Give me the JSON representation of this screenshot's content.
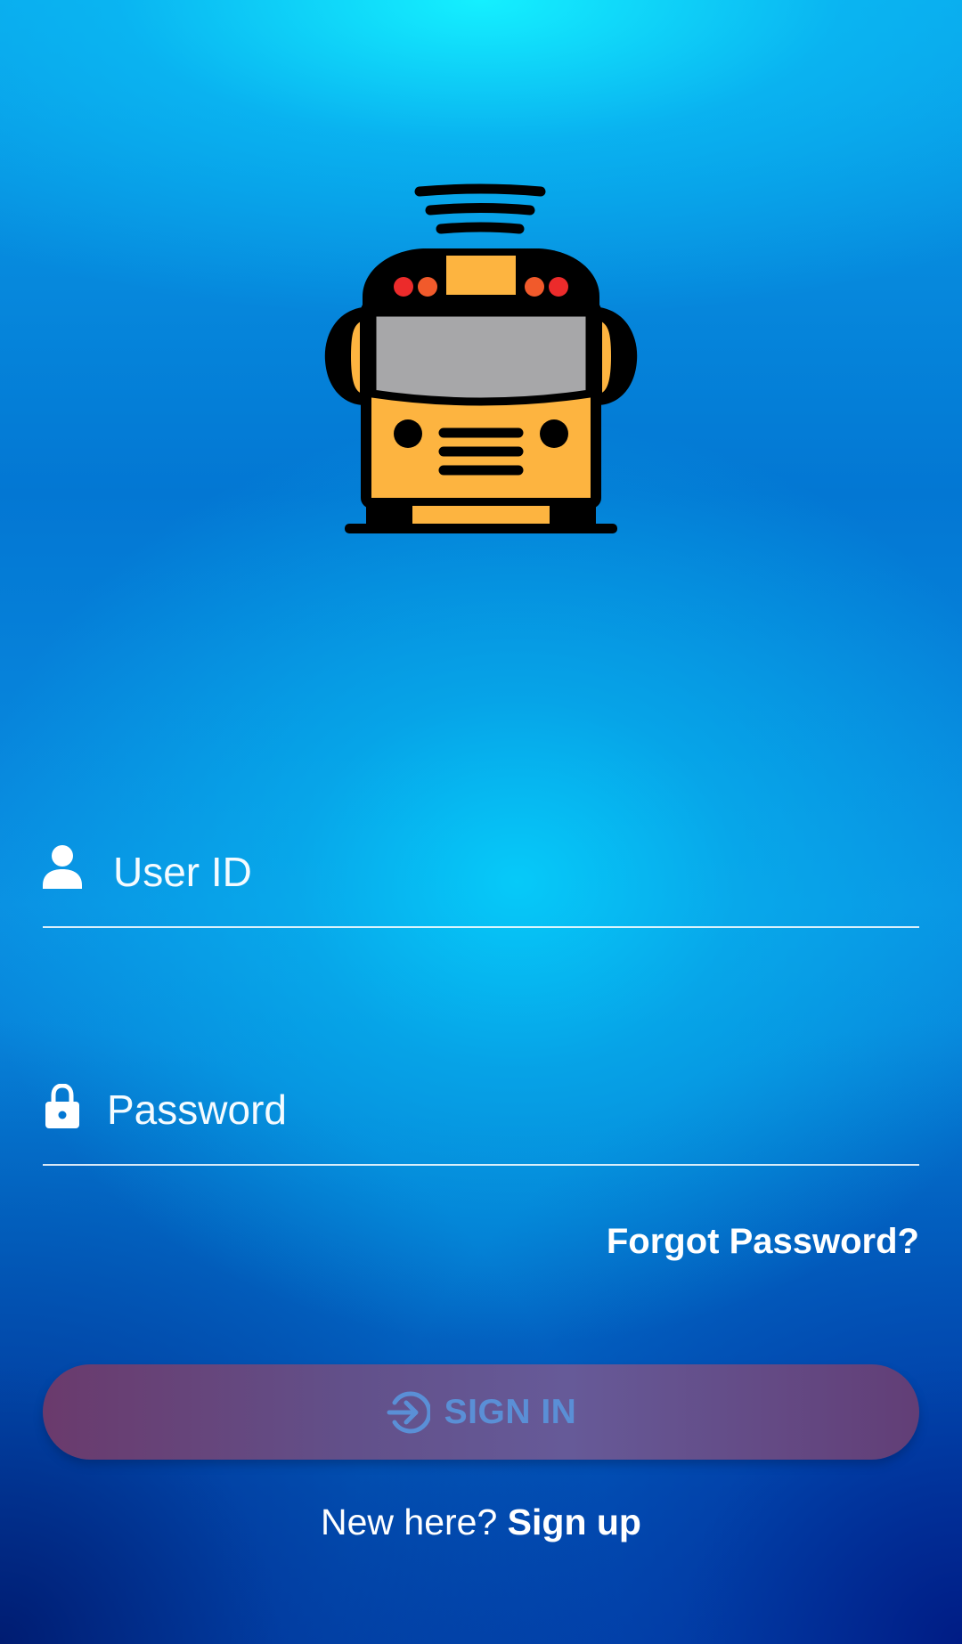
{
  "logo": {
    "icon": "school-bus-logo-icon",
    "colors": {
      "body": "#fdb440",
      "outline": "#000000",
      "windshield": "#a7a7a9",
      "lights_red": "#ec2b2b",
      "lights_orange": "#f15a2b"
    }
  },
  "form": {
    "user_id": {
      "placeholder": "User ID",
      "value": "",
      "icon": "person-icon"
    },
    "password": {
      "placeholder": "Password",
      "value": "",
      "icon": "lock-icon"
    },
    "forgot_password_label": "Forgot Password?"
  },
  "sign_in_button": {
    "label": "SIGN IN",
    "icon": "login-arrow-icon",
    "enabled": false
  },
  "signup": {
    "prompt": "New here? ",
    "link_label": "Sign up"
  }
}
